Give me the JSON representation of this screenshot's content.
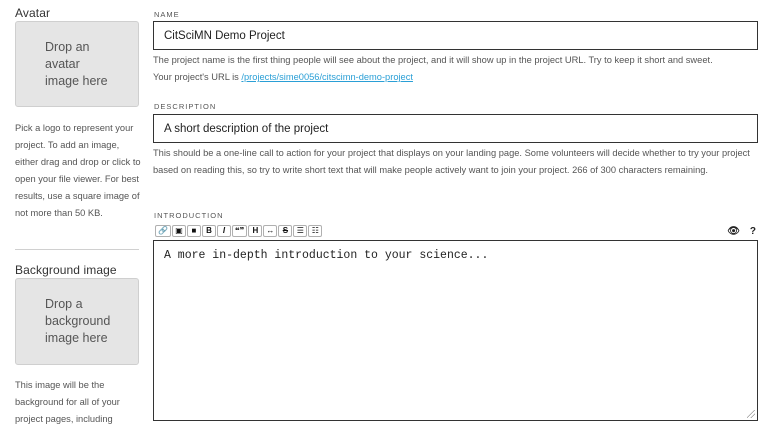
{
  "avatar": {
    "heading": "Avatar",
    "drop_text": "Drop an avatar image here",
    "help": "Pick a logo to represent your project. To add an image, either drag and drop or click to open your file viewer. For best results, use a square image of not more than 50 KB."
  },
  "background": {
    "heading": "Background image",
    "drop_text": "Drop a background image here",
    "help": "This image will be the background for all of your project pages, including"
  },
  "name": {
    "label": "NAME",
    "value": "CitSciMN Demo Project",
    "help": "The project name is the first thing people will see about the project, and it will show up in the project URL. Try to keep it short and sweet.",
    "url_prefix": "Your project's URL is ",
    "url": "/projects/sime0056/citscimn-demo-project"
  },
  "description": {
    "label": "DESCRIPTION",
    "value": "A short description of the project",
    "help": "This should be a one-line call to action for your project that displays on your landing page. Some volunteers will decide whether to try your project based on reading this, so try to write short text that will make people actively want to join your project. 266 of 300 characters remaining."
  },
  "introduction": {
    "label": "INTRODUCTION",
    "value": "A more in-depth introduction to your science...",
    "toolbar": {
      "link": "🔗",
      "image": "▣",
      "video": "■",
      "bold": "B",
      "italic": "I",
      "quote": "❝❞",
      "heading": "H",
      "hr": "↔",
      "strike": "S",
      "bullets": "☰",
      "numbers": "☷",
      "preview": "👁",
      "help": "?"
    }
  }
}
